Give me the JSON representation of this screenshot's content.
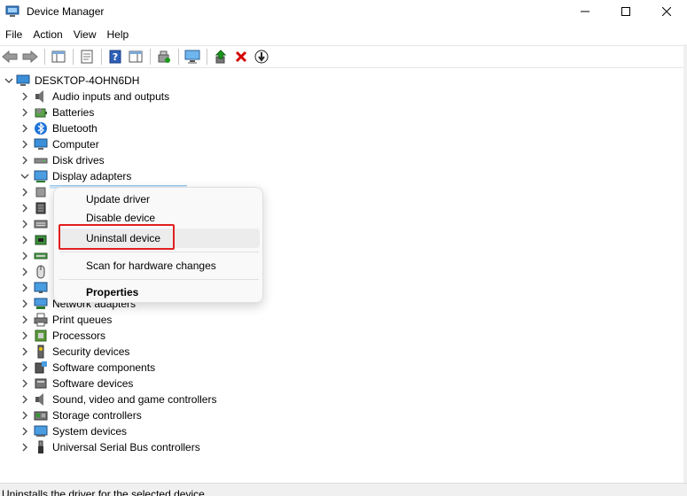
{
  "window": {
    "title": "Device Manager"
  },
  "menubar": {
    "items": [
      "File",
      "Action",
      "View",
      "Help"
    ]
  },
  "tree": {
    "root": "DESKTOP-4OHN6DH",
    "categories": [
      {
        "label": "Audio inputs and outputs",
        "icon": "speaker-icon"
      },
      {
        "label": "Batteries",
        "icon": "battery-icon"
      },
      {
        "label": "Bluetooth",
        "icon": "bluetooth-icon"
      },
      {
        "label": "Computer",
        "icon": "computer-icon"
      },
      {
        "label": "Disk drives",
        "icon": "disk-drive-icon"
      },
      {
        "label": "Display adapters",
        "icon": "display-adapter-icon",
        "expanded": true
      },
      {
        "label": "",
        "icon": "firmware-icon"
      },
      {
        "label": "",
        "icon": "hid-icon"
      },
      {
        "label": "",
        "icon": "keyboard-icon"
      },
      {
        "label": "",
        "icon": "chip-icon"
      },
      {
        "label": "",
        "icon": "ide-icon"
      },
      {
        "label": "",
        "icon": "mouse-icon"
      },
      {
        "label": "Monitors",
        "icon": "monitor-icon"
      },
      {
        "label": "Network adapters",
        "icon": "network-adapter-icon"
      },
      {
        "label": "Print queues",
        "icon": "printer-icon"
      },
      {
        "label": "Processors",
        "icon": "processor-icon"
      },
      {
        "label": "Security devices",
        "icon": "security-device-icon"
      },
      {
        "label": "Software components",
        "icon": "software-component-icon"
      },
      {
        "label": "Software devices",
        "icon": "software-device-icon"
      },
      {
        "label": "Sound, video and game controllers",
        "icon": "sound-icon"
      },
      {
        "label": "Storage controllers",
        "icon": "storage-icon"
      },
      {
        "label": "System devices",
        "icon": "system-device-icon"
      },
      {
        "label": "Universal Serial Bus controllers",
        "icon": "usb-icon"
      }
    ]
  },
  "context_menu": {
    "update_driver": "Update driver",
    "disable_device": "Disable device",
    "uninstall_device": "Uninstall device",
    "scan_hardware": "Scan for hardware changes",
    "properties": "Properties"
  },
  "status": {
    "text": "Uninstalls the driver for the selected device."
  },
  "colors": {
    "highlight": "#e02020",
    "accent": "#0078d4",
    "remove": "#d40000",
    "update": "#1a9a1a"
  }
}
